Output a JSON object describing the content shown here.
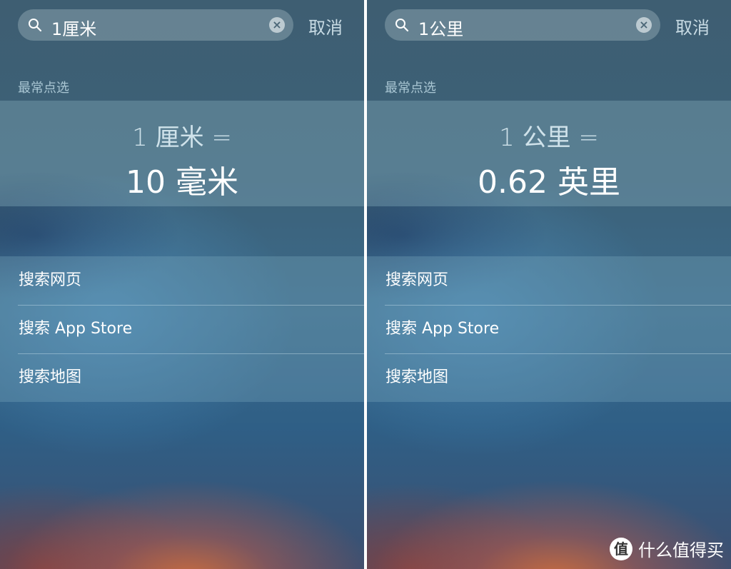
{
  "panels": [
    {
      "query": "1厘米",
      "cancel": "取消",
      "section": "最常点选",
      "from": "1 厘米 =",
      "to": "10 毫米",
      "rows": [
        "搜索网页",
        "搜索 App Store",
        "搜索地图"
      ]
    },
    {
      "query": "1公里",
      "cancel": "取消",
      "section": "最常点选",
      "from": "1 公里 =",
      "to": "0.62 英里",
      "rows": [
        "搜索网页",
        "搜索 App Store",
        "搜索地图"
      ]
    }
  ],
  "watermark": {
    "logo": "值",
    "text": "什么值得买"
  },
  "icons": {
    "search": "magnifier-icon",
    "clear": "clear-x-icon"
  }
}
